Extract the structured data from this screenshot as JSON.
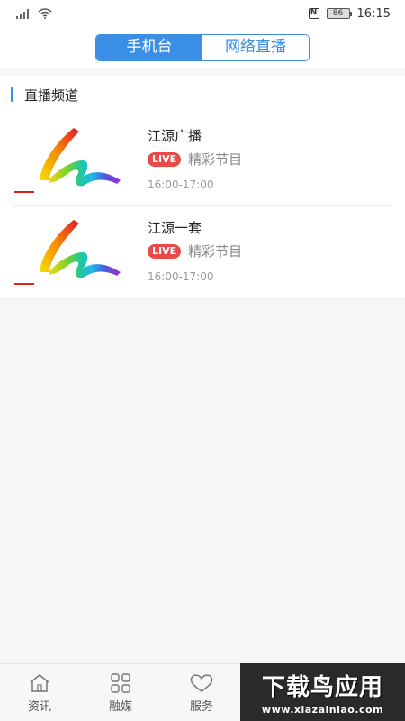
{
  "status_bar": {
    "battery": "86",
    "time": "16:15",
    "nfc": "N"
  },
  "tabs": {
    "items": [
      {
        "label": "手机台",
        "active": true
      },
      {
        "label": "网络直播",
        "active": false
      }
    ]
  },
  "section": {
    "title": "直播频道"
  },
  "channels": [
    {
      "name": "江源广播",
      "badge": "LIVE",
      "program": "精彩节目",
      "time": "16:00-17:00"
    },
    {
      "name": "江源一套",
      "badge": "LIVE",
      "program": "精彩节目",
      "time": "16:00-17:00"
    }
  ],
  "bottom_nav": {
    "items": [
      {
        "label": "资讯",
        "icon": "home-icon"
      },
      {
        "label": "融媒",
        "icon": "grid-icon"
      },
      {
        "label": "服务",
        "icon": "heart-icon"
      }
    ]
  },
  "watermark": {
    "main": "下载鸟应用",
    "url": "www.xiazainiao.com"
  },
  "colors": {
    "accent": "#3a8ee6",
    "live": "#e84a4a"
  }
}
